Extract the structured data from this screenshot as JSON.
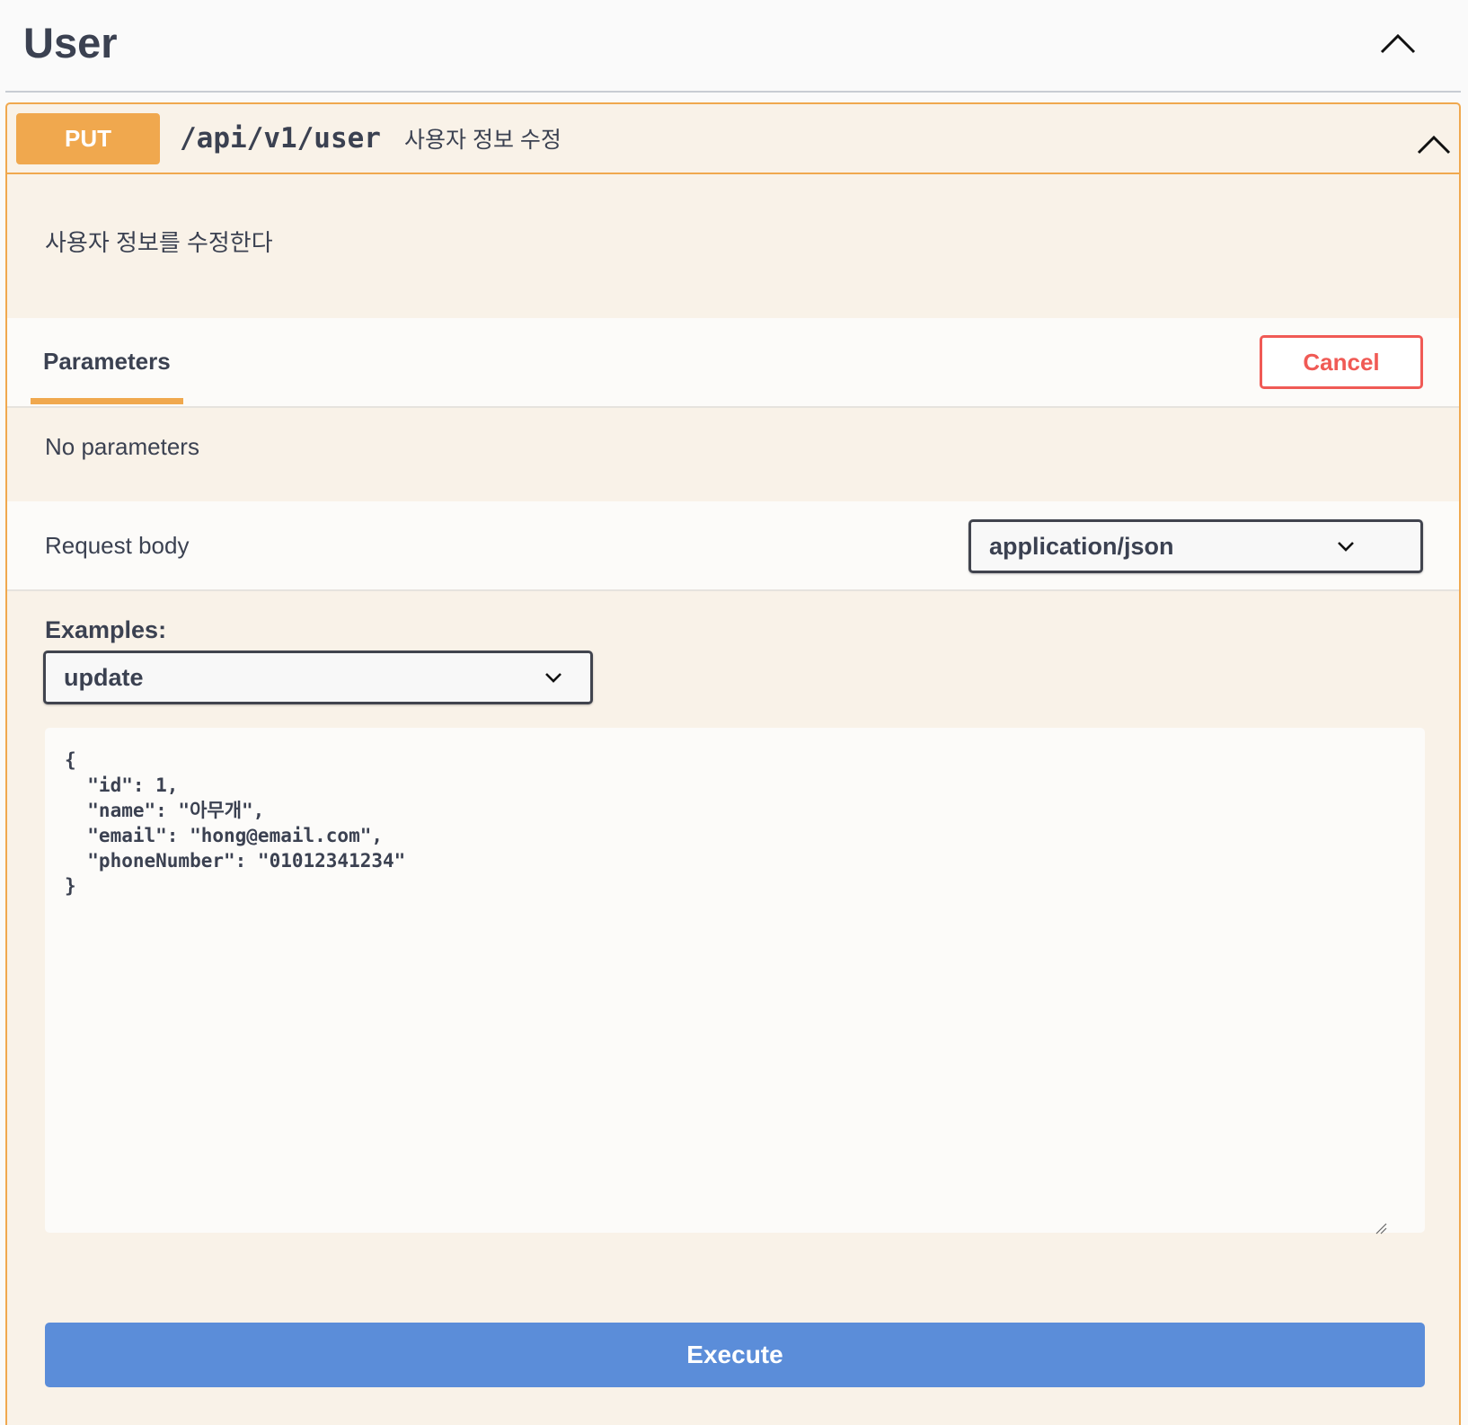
{
  "tag": {
    "title": "User",
    "icon": "chevron-up-icon"
  },
  "operation": {
    "method": "PUT",
    "method_color": "#f0a84e",
    "path": "/api/v1/user",
    "summary": "사용자 정보 수정",
    "description": "사용자 정보를 수정한다",
    "icon": "chevron-up-icon"
  },
  "parameters": {
    "tab_label": "Parameters",
    "cancel_label": "Cancel",
    "cancel_color": "#f05a55",
    "empty_text": "No parameters"
  },
  "request_body": {
    "label": "Request body",
    "content_type": "application/json",
    "examples_label": "Examples:",
    "selected_example": "update",
    "code_lines": [
      "{",
      "  \"id\": 1,",
      "  \"name\": \"아무개\",",
      "  \"email\": \"hong@email.com\",",
      "  \"phoneNumber\": \"01012341234\"",
      "}"
    ]
  },
  "execute": {
    "label": "Execute",
    "color": "#5b8dd9"
  }
}
